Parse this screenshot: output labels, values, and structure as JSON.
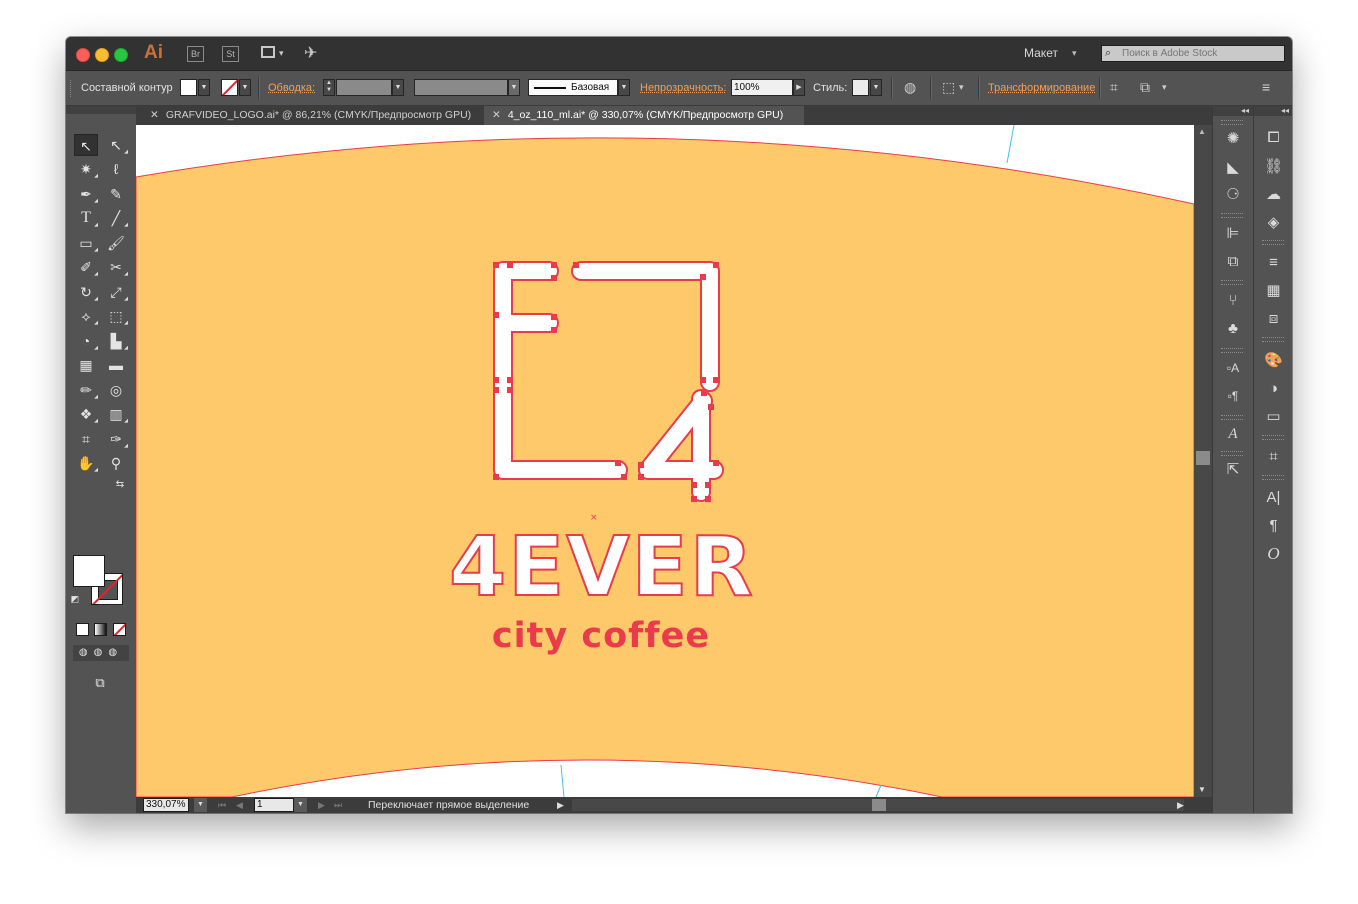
{
  "app": {
    "logo": "Ai",
    "badges": [
      "Br",
      "St"
    ],
    "layout_label": "Макет",
    "stock_search_placeholder": "Поиск в Adobe Stock"
  },
  "control_bar": {
    "selection_type": "Составной контур",
    "stroke_label": "Обводка:",
    "stroke_profile": "Базовая",
    "opacity_label": "Непрозрачность:",
    "opacity_value": "100%",
    "style_label": "Стиль:",
    "transform_label": "Трансформирование"
  },
  "tabs": [
    {
      "title": "GRAFVIDEO_LOGO.ai* @ 86,21% (CMYK/Предпросмотр GPU)",
      "active": false
    },
    {
      "title": "4_oz_110_ml.ai* @ 330,07% (CMYK/Предпросмотр GPU)",
      "active": true
    }
  ],
  "artwork": {
    "background_color": "#fdc96a",
    "anchor_color": "#ea3a4c",
    "brand_name": "4EVER",
    "tagline": "city coffee",
    "monogram": [
      "F",
      "L",
      "4"
    ]
  },
  "status_bar": {
    "zoom": "330,07%",
    "page": "1",
    "hint": "Переключает прямое выделение"
  },
  "icons": {
    "tools": [
      "selection-tool-icon",
      "direct-selection-tool-icon",
      "magic-wand-icon",
      "lasso-icon",
      "pen-icon",
      "curvature-icon",
      "type-icon",
      "line-icon",
      "rectangle-icon",
      "paintbrush-icon",
      "shaper-icon",
      "scissors-icon",
      "rotate-icon",
      "scale-icon",
      "width-icon",
      "free-transform-icon",
      "shape-builder-icon",
      "graph-icon",
      "mesh-icon",
      "gradient-icon",
      "eyedropper-icon",
      "blend-icon",
      "symbol-sprayer-icon",
      "column-graph-icon",
      "artboard-icon",
      "slice-icon",
      "hand-icon",
      "zoom-icon"
    ]
  }
}
